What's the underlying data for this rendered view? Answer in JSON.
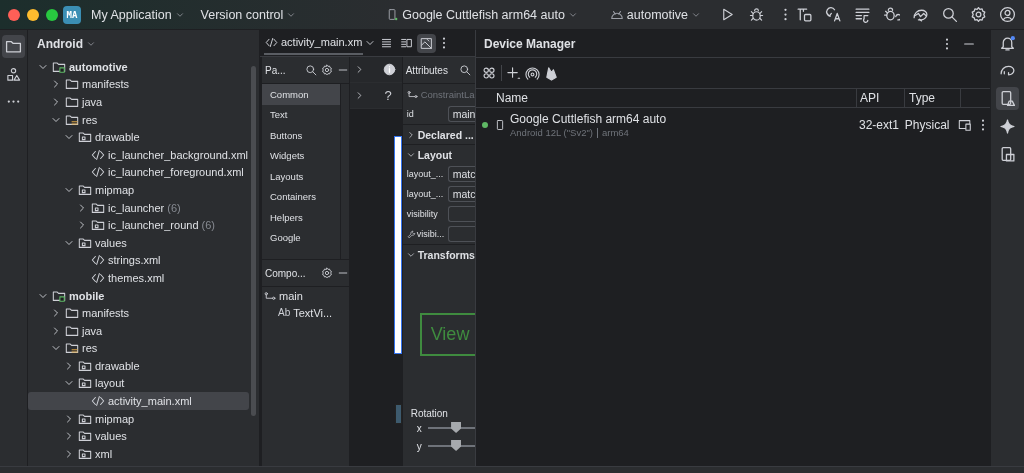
{
  "title_bar": {
    "avatar": "MA",
    "project": "My Application",
    "vcs": "Version control",
    "device": "Google Cuttlefish arm64 auto",
    "config": "automotive"
  },
  "project_panel": {
    "view": "Android",
    "tree": [
      {
        "label": "automotive",
        "kind": "module",
        "expanded": true,
        "selected": false,
        "children": [
          {
            "label": "manifests",
            "kind": "folder",
            "expanded": false,
            "selected": false
          },
          {
            "label": "java",
            "kind": "folder",
            "expanded": false,
            "selected": false
          },
          {
            "label": "res",
            "kind": "res",
            "expanded": true,
            "selected": false,
            "children": [
              {
                "label": "drawable",
                "kind": "package",
                "expanded": true,
                "selected": false,
                "children": [
                  {
                    "label": "ic_launcher_background.xml",
                    "kind": "xml",
                    "selected": false
                  },
                  {
                    "label": "ic_launcher_foreground.xml",
                    "kind": "xml",
                    "selected": false
                  }
                ]
              },
              {
                "label": "mipmap",
                "kind": "package",
                "expanded": true,
                "selected": false,
                "children": [
                  {
                    "label": "ic_launcher",
                    "count": "(6)",
                    "kind": "package",
                    "expanded": false,
                    "selected": false
                  },
                  {
                    "label": "ic_launcher_round",
                    "count": "(6)",
                    "kind": "package",
                    "expanded": false,
                    "selected": false
                  }
                ]
              },
              {
                "label": "values",
                "kind": "package",
                "expanded": true,
                "selected": false,
                "children": [
                  {
                    "label": "strings.xml",
                    "kind": "xml",
                    "selected": false
                  },
                  {
                    "label": "themes.xml",
                    "kind": "xml",
                    "selected": false
                  }
                ]
              }
            ]
          }
        ]
      },
      {
        "label": "mobile",
        "kind": "module",
        "expanded": true,
        "selected": false,
        "children": [
          {
            "label": "manifests",
            "kind": "folder",
            "expanded": false,
            "selected": false
          },
          {
            "label": "java",
            "kind": "folder",
            "expanded": false,
            "selected": false
          },
          {
            "label": "res",
            "kind": "res",
            "expanded": true,
            "selected": false,
            "children": [
              {
                "label": "drawable",
                "kind": "package",
                "expanded": false,
                "selected": false
              },
              {
                "label": "layout",
                "kind": "package",
                "expanded": true,
                "selected": false,
                "children": [
                  {
                    "label": "activity_main.xml",
                    "kind": "xml",
                    "selected": true
                  }
                ]
              },
              {
                "label": "mipmap",
                "kind": "package",
                "expanded": false,
                "selected": false
              },
              {
                "label": "values",
                "kind": "package",
                "expanded": false,
                "selected": false
              },
              {
                "label": "xml",
                "kind": "package",
                "expanded": false,
                "selected": false
              }
            ]
          }
        ]
      }
    ]
  },
  "editor": {
    "tab": "activity_main.xm",
    "view_modes": [
      {
        "kind": "code",
        "selected": false
      },
      {
        "kind": "split",
        "selected": false
      },
      {
        "kind": "design",
        "selected": true
      }
    ]
  },
  "palette": {
    "title": "Pa...",
    "categories": [
      {
        "label": "Common",
        "selected": true
      },
      {
        "label": "Text",
        "selected": false
      },
      {
        "label": "Buttons",
        "selected": false
      },
      {
        "label": "Widgets",
        "selected": false
      },
      {
        "label": "Layouts",
        "selected": false
      },
      {
        "label": "Containers",
        "selected": false
      },
      {
        "label": "Helpers",
        "selected": false
      },
      {
        "label": "Google",
        "selected": false
      }
    ]
  },
  "component_tree": {
    "title": "Compo...",
    "nodes": [
      {
        "label": "main",
        "kind": "constraint",
        "selected": false,
        "children": [
          {
            "label": "TextVi...",
            "kind": "text",
            "badge": "Ab",
            "selected": false
          }
        ]
      }
    ]
  },
  "design_surface": {
    "help": "?"
  },
  "attributes": {
    "title": "Attributes",
    "component": "ConstraintLa",
    "id_label": "id",
    "id_value": "main",
    "declared": {
      "title": "Declared ...",
      "expanded": false
    },
    "layout": {
      "title": "Layout",
      "expanded": true,
      "rows": [
        {
          "label": "layout_...",
          "value": "matc",
          "kind": "plain"
        },
        {
          "label": "layout_...",
          "value": "matc",
          "kind": "plain"
        },
        {
          "label": "visibility",
          "kind": "plain"
        },
        {
          "label": "visibi...",
          "kind": "tool"
        }
      ]
    },
    "transforms": {
      "title": "Transforms",
      "expanded": true,
      "preview": "View",
      "rotation": "Rotation",
      "axes": [
        {
          "label": "x",
          "level": 0.6
        },
        {
          "label": "y",
          "level": 0.6
        }
      ]
    }
  },
  "device_manager": {
    "title": "Device Manager",
    "columns": [
      "Name",
      "API",
      "Type"
    ],
    "devices": [
      {
        "name": "Google Cuttlefish arm64 auto",
        "os": "Android 12L (\"Sv2\")",
        "abi": "arm64",
        "api": "32-ext1",
        "type": "Physical",
        "online": true
      }
    ]
  }
}
